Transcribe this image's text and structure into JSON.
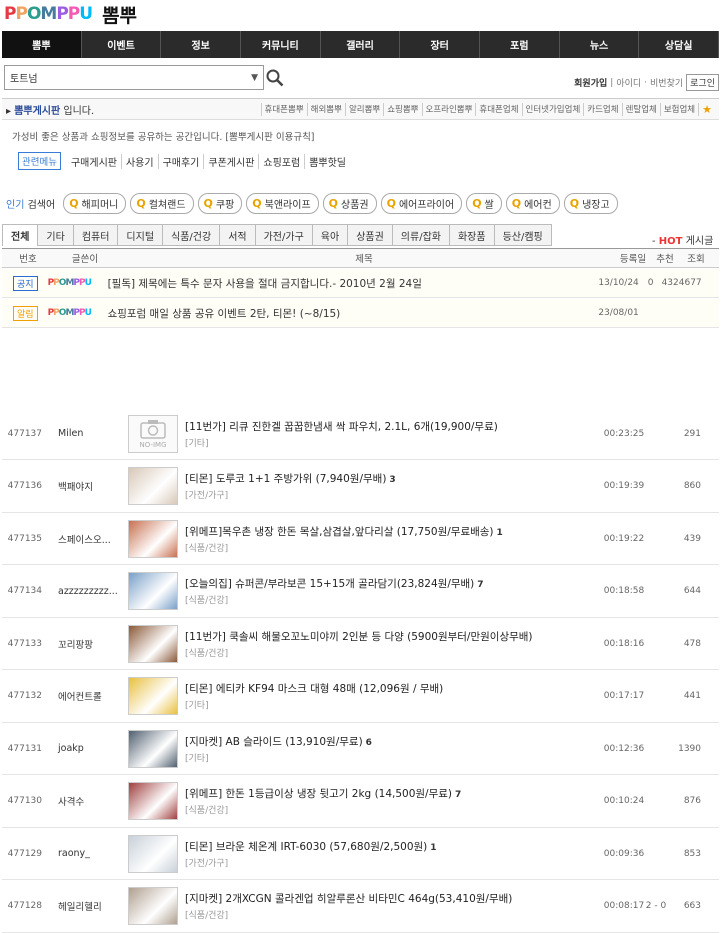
{
  "header": {
    "logo_text": "PPOMPPU",
    "logo_kr": "뽐뿌",
    "logo_colors": [
      "#e63946",
      "#f4a261",
      "#2a9d8f",
      "#457b9d",
      "#9b5de5",
      "#f15bb5",
      "#00bbf9"
    ]
  },
  "nav": [
    "뽐뿌",
    "이벤트",
    "정보",
    "커뮤니티",
    "갤러리",
    "장터",
    "포럼",
    "뉴스",
    "상담실"
  ],
  "search": {
    "value": "토트넘"
  },
  "member": {
    "join": "회원가입",
    "find_id": "아이디",
    "find_pw": "비번찾기",
    "login": "로그인"
  },
  "board": {
    "title": "뽐뿌게시판",
    "suffix": " 입니다.",
    "links": [
      "휴대폰뽐뿌",
      "해외뽐뿌",
      "알리뽐뿌",
      "쇼핑뽐뿌",
      "오프라인뽐뿌",
      "휴대폰업체",
      "인터넷가입업체",
      "카드업체",
      "렌탈업체",
      "보험업체"
    ],
    "desc": "가성비 좋은 상품과 쇼핑정보를 공유하는 공간입니다. [뽐뿌게시판 이용규칙]"
  },
  "related": {
    "tag": "관련메뉴",
    "items": [
      "구매게시판",
      "사용기",
      "구매후기",
      "쿠폰게시판",
      "쇼핑포럼",
      "뽐뿌핫딜"
    ]
  },
  "popular": {
    "label_hi": "인기",
    "label": " 검색어",
    "keywords": [
      "해피머니",
      "컬쳐랜드",
      "쿠팡",
      "북앤라이프",
      "상품권",
      "에어프라이어",
      "쌀",
      "에어컨",
      "냉장고"
    ]
  },
  "categories": [
    "전체",
    "기타",
    "컴퓨터",
    "디지털",
    "식품/건강",
    "서적",
    "가전/가구",
    "육아",
    "상품권",
    "의류/잡화",
    "화장품",
    "등산/캠핑"
  ],
  "hot": {
    "hot": "HOT",
    "label": " 게시글"
  },
  "columns": {
    "no": "번호",
    "writer": "글쓴이",
    "subject": "제목",
    "date": "등록일",
    "rec": "추천",
    "views": "조회"
  },
  "notices": [
    {
      "badge": "공지",
      "badge_color": "#2b6bd6",
      "subject": "[필독] 제목에는 특수 문자 사용을 절대 금지합니다.- 2010년 2월 24일",
      "date": "13/10/24",
      "rec": "0",
      "views": "4324677"
    },
    {
      "badge": "알림",
      "badge_color": "#f0a000",
      "subject": "쇼핑포럼 매일 상품 공유 이벤트 2탄, 티몬! (~8/15)",
      "date": "23/08/01",
      "rec": "",
      "views": ""
    }
  ],
  "posts": [
    {
      "no": "477137",
      "writer": "Milen",
      "subject": "[11번가] 리큐 진한겔 꿉꿉한냄새 싹 파우치, 2.1L, 6개(19,900/무료)",
      "comments": "",
      "cat": "[기타]",
      "date": "00:23:25",
      "rec": "",
      "views": "291",
      "thumb": "NO-IMG"
    },
    {
      "no": "477136",
      "writer": "백패야지",
      "subject": "[티몬] 도루코 1+1 주방가위 (7,940원/무배)",
      "comments": "3",
      "cat": "[가전/가구]",
      "date": "00:19:39",
      "rec": "",
      "views": "860",
      "thumb": ""
    },
    {
      "no": "477135",
      "writer": "스페이스오...",
      "subject": "[위메프]목우촌 냉장 한돈 목살,삼겹살,앞다리살 (17,750원/무료배송)",
      "comments": "1",
      "cat": "[식품/건강]",
      "date": "00:19:22",
      "rec": "",
      "views": "439",
      "thumb": ""
    },
    {
      "no": "477134",
      "writer": "azzzzzzzzz...",
      "subject": "[오늘의집] 슈퍼콘/부라보콘 15+15개 골라담기(23,824원/무배)",
      "comments": "7",
      "cat": "[식품/건강]",
      "date": "00:18:58",
      "rec": "",
      "views": "644",
      "thumb": ""
    },
    {
      "no": "477133",
      "writer": "꼬리팡팡",
      "subject": "[11번가] 쿡솔씨 해물오꼬노미야끼 2인분 등 다양 (5900원부터/만원이상무배)",
      "comments": "",
      "cat": "[식품/건강]",
      "date": "00:18:16",
      "rec": "",
      "views": "478",
      "thumb": ""
    },
    {
      "no": "477132",
      "writer": "에어컨트롤",
      "subject": "[티몬] 에티카 KF94 마스크 대형 48매 (12,096원 / 무배)",
      "comments": "",
      "cat": "[기타]",
      "date": "00:17:17",
      "rec": "",
      "views": "441",
      "thumb": ""
    },
    {
      "no": "477131",
      "writer": "joakp",
      "subject": "[지마켓] AB 슬라이드 (13,910원/무료)",
      "comments": "6",
      "cat": "[기타]",
      "date": "00:12:36",
      "rec": "",
      "views": "1390",
      "thumb": ""
    },
    {
      "no": "477130",
      "writer": "사격수",
      "subject": "[위메프] 한돈 1등급이상 냉장 뒷고기 2kg (14,500원/무료)",
      "comments": "7",
      "cat": "[식품/건강]",
      "date": "00:10:24",
      "rec": "",
      "views": "876",
      "thumb": ""
    },
    {
      "no": "477129",
      "writer": "raony_",
      "subject": "[티몬] 브라운 체온계 IRT-6030 (57,680원/2,500원)",
      "comments": "1",
      "cat": "[가전/가구]",
      "date": "00:09:36",
      "rec": "",
      "views": "853",
      "thumb": ""
    },
    {
      "no": "477128",
      "writer": "헤일리헬리",
      "subject": "[지마켓] 2개XCGN 콜라겐업 히알루론산 비타민C 464g(53,410원/무배)",
      "comments": "",
      "cat": "[식품/건강]",
      "date": "00:08:17",
      "rec": "2 - 0",
      "views": "663",
      "thumb": ""
    }
  ],
  "thumb_colors": [
    "#f2f2f2",
    "#d8c8b8",
    "#c87050",
    "#7aa0c8",
    "#8a5a3a",
    "#e8c040",
    "#506070",
    "#a04040",
    "#c8d0d8",
    "#b0a090"
  ]
}
